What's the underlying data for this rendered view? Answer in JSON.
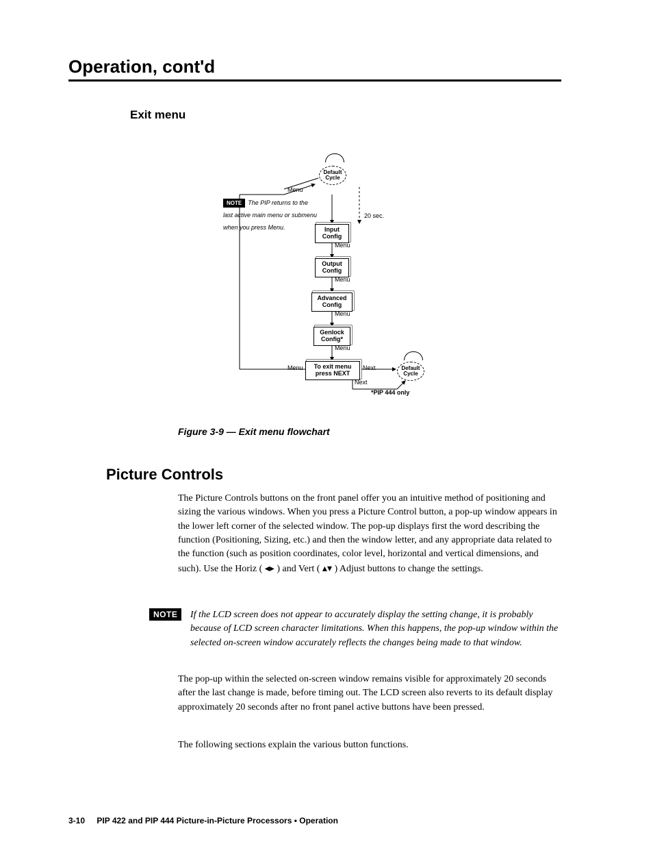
{
  "header": {
    "title": "Operation, cont'd"
  },
  "section": {
    "title": "Exit menu"
  },
  "flow": {
    "default_cycle": "Default\nCycle",
    "menu": "Menu",
    "twenty_sec": "20 sec.",
    "note_badge": "NOTE",
    "note_text": "The PIP returns to the last active main menu or submenu when you press Menu.",
    "input_config": "Input\nConfig",
    "output_config": "Output\nConfig",
    "advanced_config": "Advanced\nConfig",
    "genlock_config": "Genlock\nConfig*",
    "exit_box": "To exit menu\npress NEXT",
    "next": "Next",
    "pip444": "*PIP 444 only"
  },
  "caption": "Figure 3-9 — Exit menu flowchart",
  "heading2": "Picture Controls",
  "body": {
    "p1": "The Picture Controls buttons on the front panel offer you an intuitive method of positioning and sizing the various windows. When you press a Picture Control button, a pop-up window appears in the lower left corner of the selected window. The pop-up displays first the word describing the function (Positioning, Sizing, etc.) and then the window letter, and any appropriate data related to the function (such as position coordinates, color level, horizontal and vertical dimensions, and such). Use the Horiz ( ",
    "p1b": " ) and Vert ( ",
    "p1c": " ) Adjust buttons to change the settings.",
    "note": "If the LCD screen does not appear to accurately display the setting change, it is probably because of LCD screen character limitations. When this happens, the pop-up window within the selected on-screen window accurately reflects the changes being made to that window.",
    "p2": "The pop-up within the selected on-screen window remains visible for approximately 20 seconds after the last change is made, before timing out. The LCD screen also reverts to its default display approximately 20 seconds after no front panel active buttons have been pressed.",
    "p3": "The following sections explain the various button functions."
  },
  "note_big": "NOTE",
  "footer": {
    "page_num": "3-10",
    "text": "PIP 422 and PIP 444 Picture-in-Picture Processors • Operation"
  },
  "chart_data": {
    "type": "flowchart",
    "title": "Exit menu flowchart",
    "nodes": [
      {
        "id": "default1",
        "label": "Default Cycle",
        "shape": "ellipse-dashed"
      },
      {
        "id": "input",
        "label": "Input Config",
        "shape": "box-doubled"
      },
      {
        "id": "output",
        "label": "Output Config",
        "shape": "box-doubled"
      },
      {
        "id": "advanced",
        "label": "Advanced Config",
        "shape": "box-doubled"
      },
      {
        "id": "genlock",
        "label": "Genlock Config*",
        "shape": "box-doubled",
        "note": "*PIP 444 only"
      },
      {
        "id": "exit",
        "label": "To exit menu press NEXT",
        "shape": "box-doubled"
      },
      {
        "id": "default2",
        "label": "Default Cycle",
        "shape": "ellipse-dashed"
      }
    ],
    "edges": [
      {
        "from": "default1",
        "to": "default1",
        "label": "",
        "type": "loop"
      },
      {
        "from": "default1",
        "to": "input",
        "label": "Menu"
      },
      {
        "from": "default1",
        "to": "input",
        "label": "20 sec.",
        "style": "dashed",
        "direction": "down"
      },
      {
        "from": "input",
        "to": "output",
        "label": "Menu"
      },
      {
        "from": "output",
        "to": "advanced",
        "label": "Menu"
      },
      {
        "from": "advanced",
        "to": "genlock",
        "label": "Menu"
      },
      {
        "from": "genlock",
        "to": "exit",
        "label": "Menu"
      },
      {
        "from": "exit",
        "to": "default2",
        "label": "Next"
      },
      {
        "from": "exit",
        "to": "default1",
        "label": "Menu",
        "type": "return-left"
      },
      {
        "from": "exit",
        "to": "default2",
        "label": "Next",
        "type": "down-right"
      },
      {
        "from": "default2",
        "to": "default2",
        "label": "",
        "type": "loop"
      }
    ],
    "annotations": [
      {
        "type": "note",
        "text": "The PIP returns to the last active main menu or submenu when you press Menu."
      }
    ]
  }
}
